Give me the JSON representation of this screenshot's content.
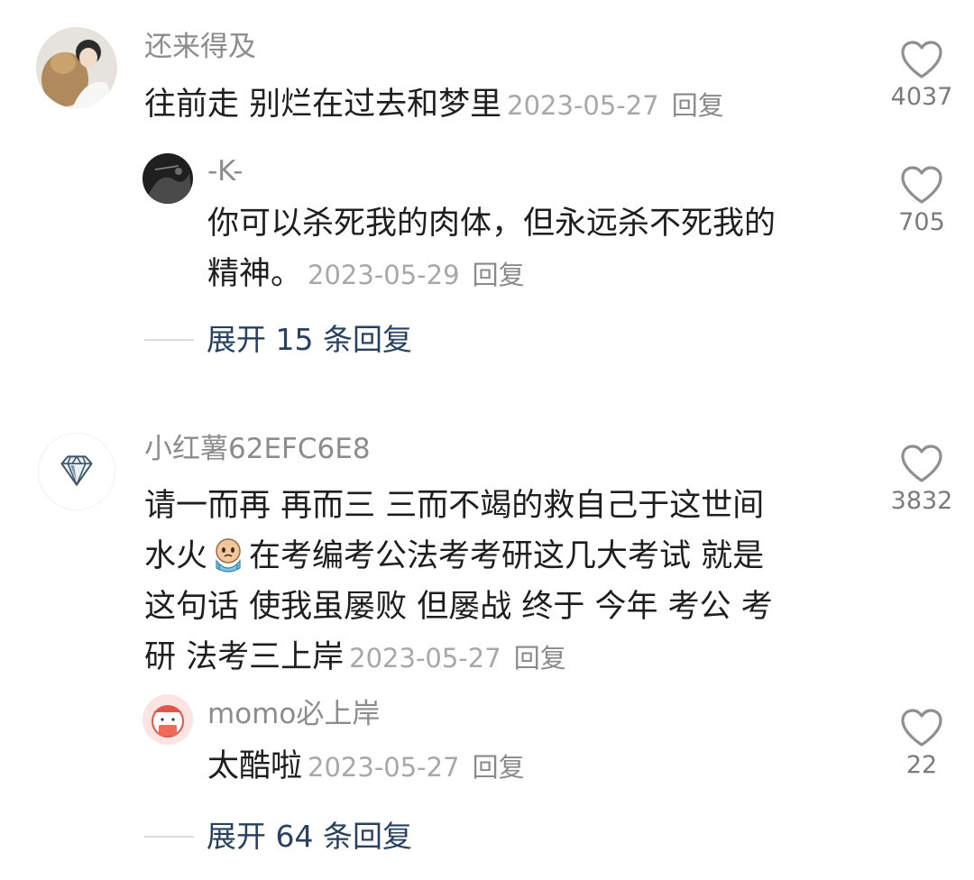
{
  "comments": [
    {
      "username": "还来得及",
      "text": "往前走 别烂在过去和梦里",
      "date": "2023-05-27",
      "reply_label": "回复",
      "likes": "4037",
      "avatar": "photo-avatar-person-with-dog",
      "sub_reply": {
        "username": "-K-",
        "text_line1": "你可以杀死我的肉体，但永远杀不死我的",
        "text_line2": "精神。",
        "date": "2023-05-29",
        "reply_label": "回复",
        "likes": "705",
        "avatar": "dark-photo-avatar"
      },
      "expand_label": "展开 15 条回复"
    },
    {
      "username": "小红薯62EFC6E8",
      "text_line1": "请一而再 再而三 三而不竭的救自己于这世间",
      "text_line2a": "水火",
      "emoji": "crying-face-emoji",
      "text_line2b": "在考编考公法考考研这几大考试 就是",
      "text_line3": "这句话 使我虽屡败 但屡战 终于 今年 考公 考",
      "text_line4": "研 法考三上岸",
      "date": "2023-05-27",
      "reply_label": "回复",
      "likes": "3832",
      "avatar": "diamond-icon-avatar",
      "sub_reply": {
        "username": "momo必上岸",
        "text": "太酷啦",
        "date": "2023-05-27",
        "reply_label": "回复",
        "likes": "22",
        "avatar": "cartoon-avatar-red"
      },
      "expand_label": "展开 64 条回复"
    }
  ],
  "colors": {
    "username": "#8c8c8c",
    "text": "#1e1e1e",
    "date": "#a8a8a8",
    "expand": "#27415f",
    "heart": "#8f8f8f"
  }
}
